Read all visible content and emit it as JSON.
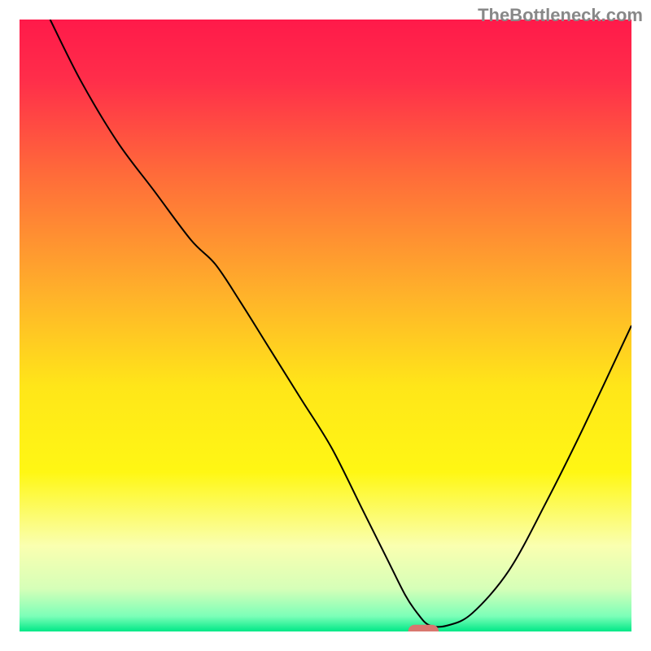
{
  "watermark": "TheBottleneck.com",
  "chart_data": {
    "type": "line",
    "title": "",
    "xlabel": "",
    "ylabel": "",
    "xlim": [
      0,
      100
    ],
    "ylim": [
      0,
      100
    ],
    "legend": false,
    "axes_visible": false,
    "background_gradient": {
      "stops": [
        {
          "offset": 0.0,
          "color": "#ff1a4a"
        },
        {
          "offset": 0.1,
          "color": "#ff2e4a"
        },
        {
          "offset": 0.25,
          "color": "#ff6a3a"
        },
        {
          "offset": 0.45,
          "color": "#ffb22a"
        },
        {
          "offset": 0.6,
          "color": "#ffe619"
        },
        {
          "offset": 0.74,
          "color": "#fff714"
        },
        {
          "offset": 0.86,
          "color": "#faffb0"
        },
        {
          "offset": 0.93,
          "color": "#d6ffb8"
        },
        {
          "offset": 0.975,
          "color": "#7cffb8"
        },
        {
          "offset": 1.0,
          "color": "#00e887"
        }
      ]
    },
    "series": [
      {
        "name": "bottleneck-curve",
        "color": "#000000",
        "width": 2,
        "x": [
          5,
          10,
          16,
          22,
          28,
          32,
          36,
          41,
          46,
          51,
          56,
          60,
          63,
          65,
          67,
          70,
          74,
          80,
          86,
          92,
          100
        ],
        "y": [
          100,
          90,
          80,
          72,
          64,
          60,
          54,
          46,
          38,
          30,
          20,
          12,
          6,
          3,
          1,
          1,
          3,
          10,
          21,
          33,
          50
        ]
      }
    ],
    "marker": {
      "name": "optimal-marker",
      "shape": "rounded-rect",
      "x": 66,
      "y": 0,
      "width": 5,
      "height": 2.2,
      "color": "#d9776f"
    }
  }
}
